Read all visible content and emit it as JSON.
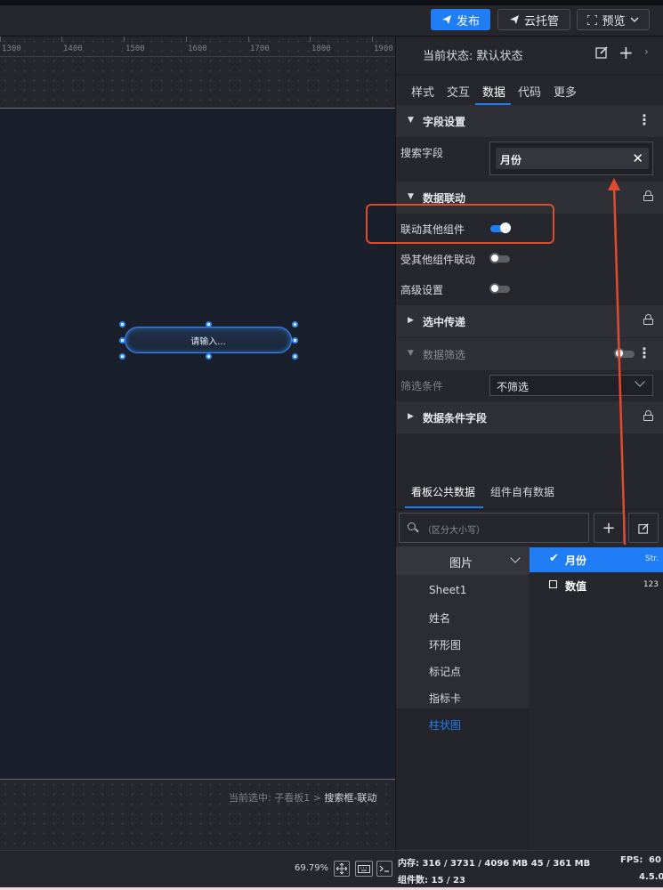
{
  "toolbar": {
    "publish_label": "发布",
    "cloud_label": "云托管",
    "preview_label": "预览"
  },
  "ruler": {
    "labels": [
      "1300",
      "1400",
      "1500",
      "1600",
      "1700",
      "1800",
      "1900"
    ]
  },
  "canvas": {
    "search_placeholder": "请输入...",
    "breadcrumb_prefix": "当前选中: 子看板1 > ",
    "breadcrumb_current": "搜索框-联动",
    "zoom": "69.79%"
  },
  "panel": {
    "state_label": "当前状态:",
    "state_value": "默认状态",
    "tabs": [
      "样式",
      "交互",
      "数据",
      "代码",
      "更多"
    ],
    "active_tab": "数据",
    "field_settings": {
      "title": "字段设置",
      "search_field_label": "搜索字段",
      "search_field_value": "月份"
    },
    "data_linkage": {
      "title": "数据联动",
      "rows": [
        {
          "label": "联动其他组件",
          "on": true
        },
        {
          "label": "受其他组件联动",
          "on": false
        },
        {
          "label": "高级设置",
          "on": false
        }
      ]
    },
    "selection_pass": {
      "title": "选中传递"
    },
    "data_filter": {
      "title": "数据筛选",
      "condition_label": "筛选条件",
      "condition_value": "不筛选"
    },
    "data_condition_fields": {
      "title": "数据条件字段"
    },
    "data_tabs": [
      "看板公共数据",
      "组件自有数据"
    ],
    "data_search_placeholder": "（区分大小写）",
    "source_group": "图片",
    "sources": [
      "Sheet1",
      "姓名",
      "环形图",
      "标记点",
      "指标卡",
      "柱状图"
    ],
    "active_source": "柱状图",
    "fields": [
      {
        "name": "月份",
        "type": "Str.",
        "checked": true
      },
      {
        "name": "数值",
        "type": "123",
        "checked": false
      }
    ]
  },
  "status": {
    "memory": "内存:  316 / 3731 / 4096 MB  45 / 361 MB",
    "fps_label": "FPS:",
    "fps_value": "60",
    "components": "组件数: 15 / 23",
    "version": "4.5.0"
  },
  "colors": {
    "accent": "#1f7ef5",
    "annotation": "#e04a2f"
  }
}
